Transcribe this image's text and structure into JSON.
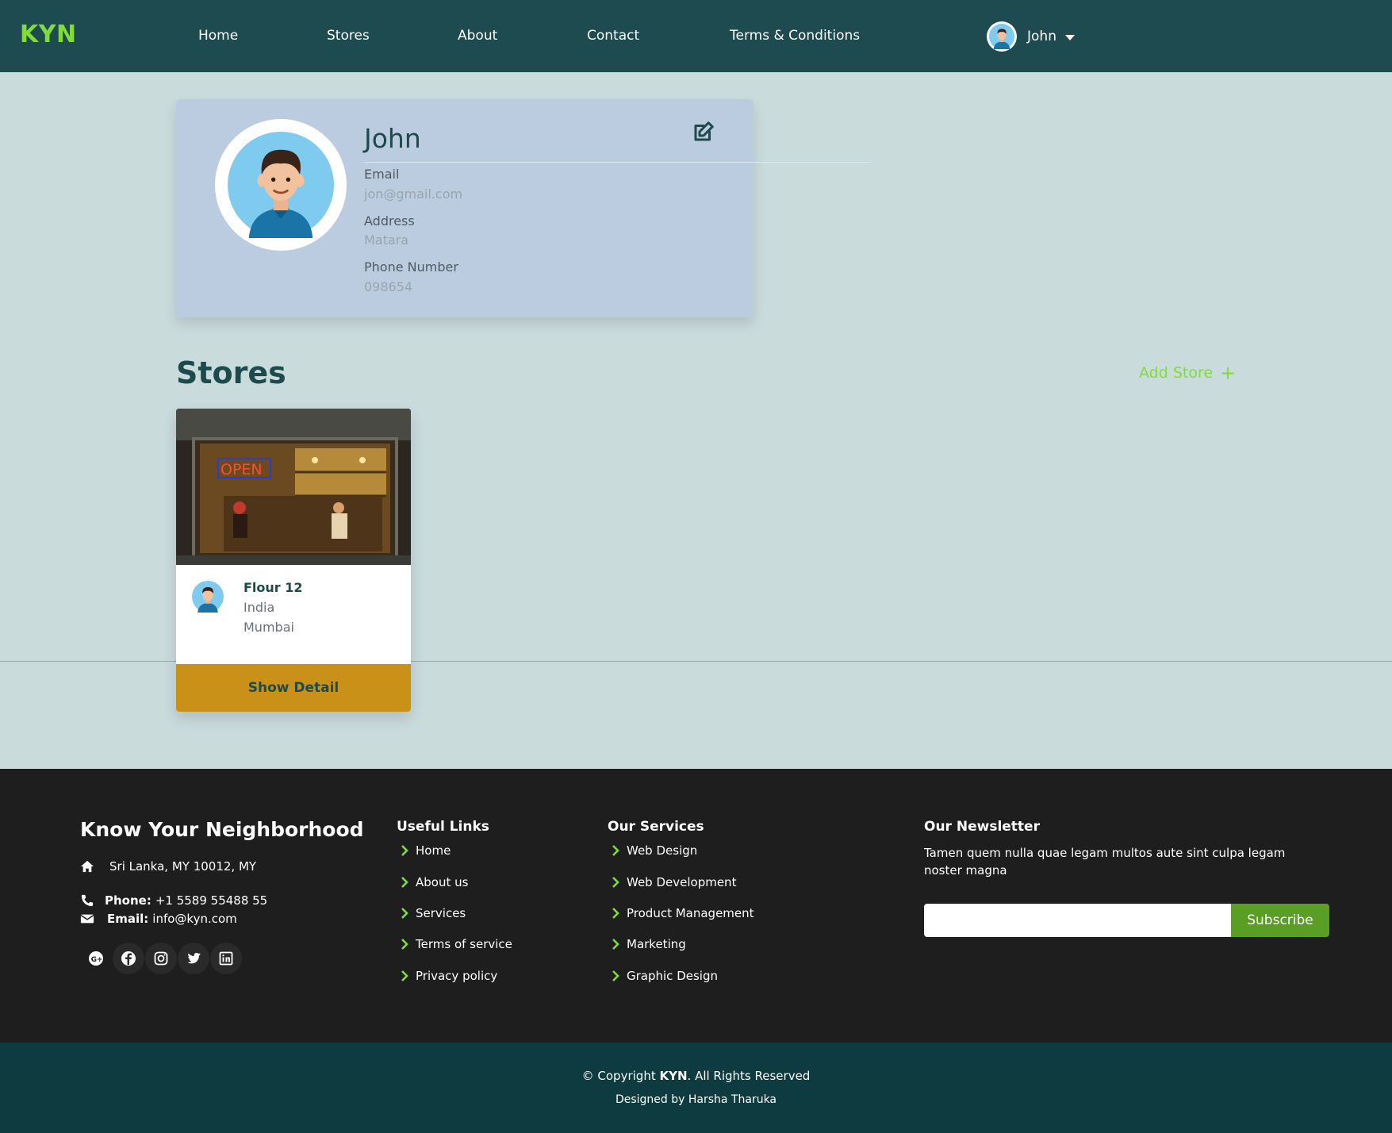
{
  "navbar": {
    "logo": "KYN",
    "links": [
      "Home",
      "Stores",
      "About",
      "Contact",
      "Terms & Conditions"
    ],
    "user_name": "John"
  },
  "profile": {
    "name": "John",
    "email_label": "Email",
    "email": "jon@gmail.com",
    "address_label": "Address",
    "address": "Matara",
    "phone_label": "Phone Number",
    "phone": "098654"
  },
  "stores": {
    "title": "Stores",
    "add_label": "Add Store",
    "add_icon": "+",
    "items": [
      {
        "name": "Flour 12",
        "country": "India",
        "city": "Mumbai",
        "button": "Show Detail",
        "sign_text": "OPEN"
      }
    ]
  },
  "footer": {
    "brand": "Know Your Neighborhood",
    "address": "Sri Lanka, MY 10012, MY",
    "phone_label": "Phone:",
    "phone": "+1 5589 55488 55",
    "email_label": "Email:",
    "email": "info@kyn.com",
    "useful_links_title": "Useful Links",
    "useful_links": [
      "Home",
      "About us",
      "Services",
      "Terms of service",
      "Privacy policy"
    ],
    "services_title": "Our Services",
    "services": [
      "Web Design",
      "Web Development",
      "Product Management",
      "Marketing",
      "Graphic Design"
    ],
    "newsletter_title": "Our Newsletter",
    "newsletter_text": "Tamen quem nulla quae legam multos aute sint culpa legam noster magna",
    "newsletter_input": "",
    "subscribe": "Subscribe",
    "copyright_prefix": "© Copyright ",
    "copyright_brand": "KYN",
    "copyright_suffix": ". All Rights Reserved",
    "designed_by": "Designed by Harsha Tharuka"
  },
  "colors": {
    "navbar_bg": "#1d4b4f",
    "accent_green": "#7fdc3a",
    "page_bg": "#cadbdc",
    "profile_card_bg": "#bccce0",
    "button_gold": "#c99117",
    "footer_bg": "#1e1e1e",
    "copyright_bg": "#0d3b3f",
    "subscribe_green": "#5a9e26"
  }
}
